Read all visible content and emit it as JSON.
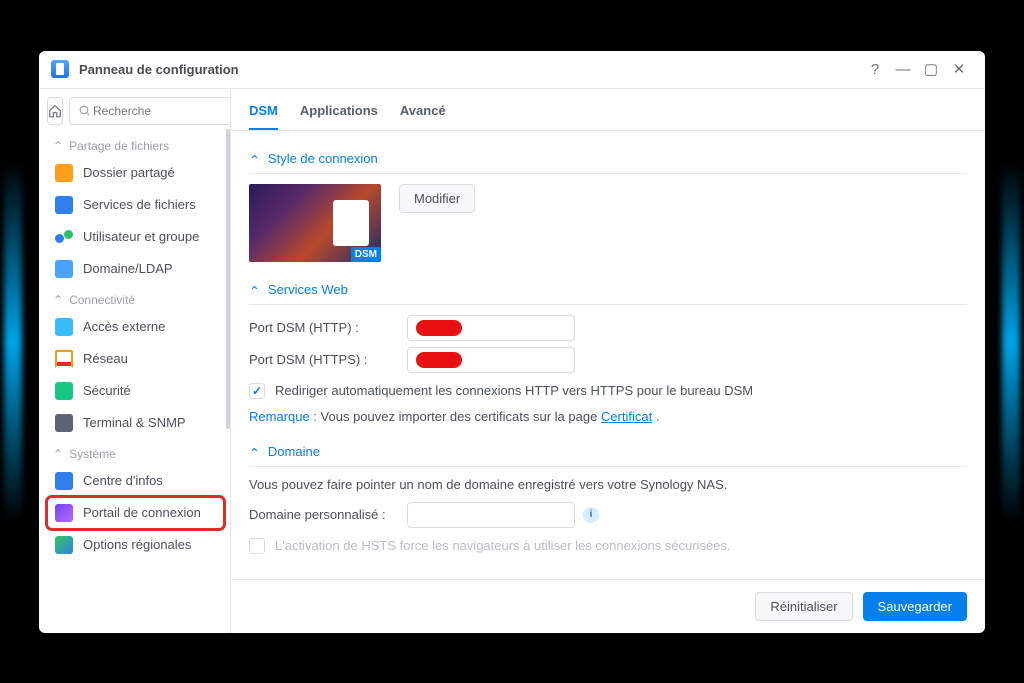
{
  "window": {
    "title": "Panneau de configuration"
  },
  "search": {
    "placeholder": "Recherche"
  },
  "sidebar": {
    "sections": [
      {
        "label": "Partage de fichiers",
        "items": [
          {
            "id": "shared-folder",
            "label": "Dossier partagé"
          },
          {
            "id": "file-services",
            "label": "Services de fichiers"
          },
          {
            "id": "user-group",
            "label": "Utilisateur et groupe"
          },
          {
            "id": "domain-ldap",
            "label": "Domaine/LDAP"
          }
        ]
      },
      {
        "label": "Connectivité",
        "items": [
          {
            "id": "external-access",
            "label": "Accès externe"
          },
          {
            "id": "network",
            "label": "Réseau"
          },
          {
            "id": "security",
            "label": "Sécurité"
          },
          {
            "id": "terminal-snmp",
            "label": "Terminal & SNMP"
          }
        ]
      },
      {
        "label": "Système",
        "items": [
          {
            "id": "info-center",
            "label": "Centre d'infos"
          },
          {
            "id": "login-portal",
            "label": "Portail de connexion"
          },
          {
            "id": "regional",
            "label": "Options régionales"
          }
        ]
      }
    ],
    "selected": "login-portal"
  },
  "tabs": [
    {
      "id": "dsm",
      "label": "DSM",
      "active": true
    },
    {
      "id": "apps",
      "label": "Applications"
    },
    {
      "id": "adv",
      "label": "Avancé"
    }
  ],
  "sections": {
    "style": {
      "title": "Style de connexion",
      "thumb_badge": "DSM",
      "modify": "Modifier"
    },
    "web": {
      "title": "Services Web",
      "http_label": "Port DSM (HTTP) :",
      "https_label": "Port DSM (HTTPS) :",
      "http_value": "(censuré)",
      "https_value": "(censuré)",
      "redirect_label": "Rediriger automatiquement les connexions HTTP vers HTTPS pour le bureau DSM",
      "redirect_checked": true,
      "note_prefix": "Remarque :",
      "note_text": "Vous pouvez importer des certificats sur la page ",
      "note_link": "Certificat",
      "note_suffix": " ."
    },
    "domain": {
      "title": "Domaine",
      "desc": "Vous pouvez faire pointer un nom de domaine enregistré vers votre Synology NAS.",
      "custom_label": "Domaine personnalisé :",
      "custom_value": "",
      "hsts_label": "L'activation de HSTS force les navigateurs à utiliser les connexions sécurisées.",
      "hsts_checked": false
    }
  },
  "footer": {
    "reset": "Réinitialiser",
    "save": "Sauvegarder"
  }
}
